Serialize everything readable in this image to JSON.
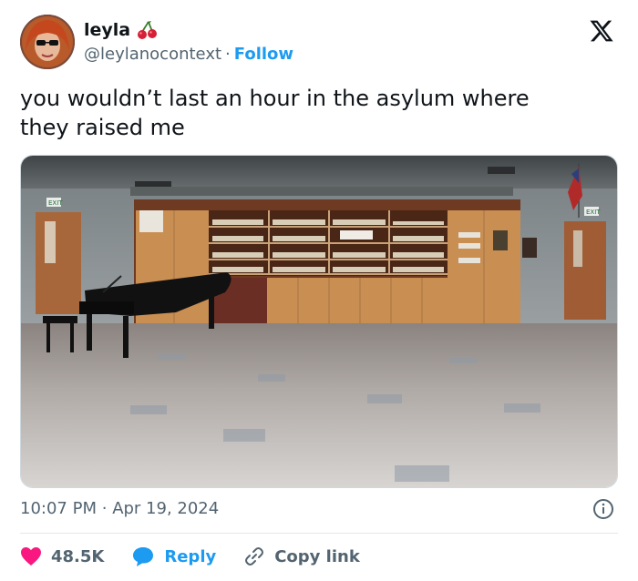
{
  "user": {
    "display_name": "leyla",
    "handle": "@leylanocontext",
    "separator": "·",
    "follow_label": "Follow",
    "emoji_icon": "cherries-icon"
  },
  "tweet": {
    "text_line1": "you wouldn’t last an hour in the asylum where",
    "text_line2": "they raised me"
  },
  "media": {
    "exit_sign_left": "EXIT",
    "exit_sign_right": "EXIT"
  },
  "meta": {
    "time": "10:07 PM",
    "separator": "·",
    "date": "Apr 19, 2024"
  },
  "actions": {
    "like_count": "48.5K",
    "reply_label": "Reply",
    "copy_link_label": "Copy link"
  },
  "colors": {
    "accent": "#1d9bf0",
    "like": "#f91880",
    "muted": "#536471",
    "text": "#0f1419"
  }
}
